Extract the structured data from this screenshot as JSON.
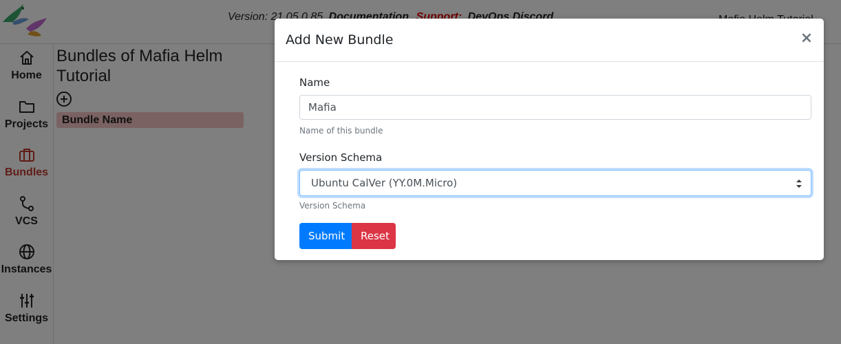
{
  "header": {
    "version_label": "Version:",
    "version_number": "21.05.0.85",
    "documentation_link": "Documentation",
    "support_label": "Support:",
    "support_link": "DevOps Discord",
    "user_label": "Mafia Helm Tutorial"
  },
  "sidebar": {
    "items": [
      {
        "label": "Home",
        "icon": "home-icon"
      },
      {
        "label": "Projects",
        "icon": "folder-icon"
      },
      {
        "label": "Bundles",
        "icon": "briefcase-icon",
        "active": true
      },
      {
        "label": "VCS",
        "icon": "branch-icon"
      },
      {
        "label": "Instances",
        "icon": "globe-icon"
      },
      {
        "label": "Settings",
        "icon": "sliders-icon"
      }
    ]
  },
  "main": {
    "title": "Bundles of Mafia Helm Tutorial",
    "table_header": "Bundle Name"
  },
  "modal": {
    "title": "Add New Bundle",
    "close_symbol": "×",
    "name_label": "Name",
    "name_value": "Mafia",
    "name_help": "Name of this bundle",
    "schema_label": "Version Schema",
    "schema_selected": "Ubuntu CalVer (YY.0M.Micro)",
    "schema_help": "Version Schema",
    "submit_label": "Submit",
    "reset_label": "Reset"
  },
  "colors": {
    "accent": "#007bff",
    "danger": "#dc3545",
    "active_nav": "#c0392b",
    "table_header_bg": "#f6c5c5"
  }
}
